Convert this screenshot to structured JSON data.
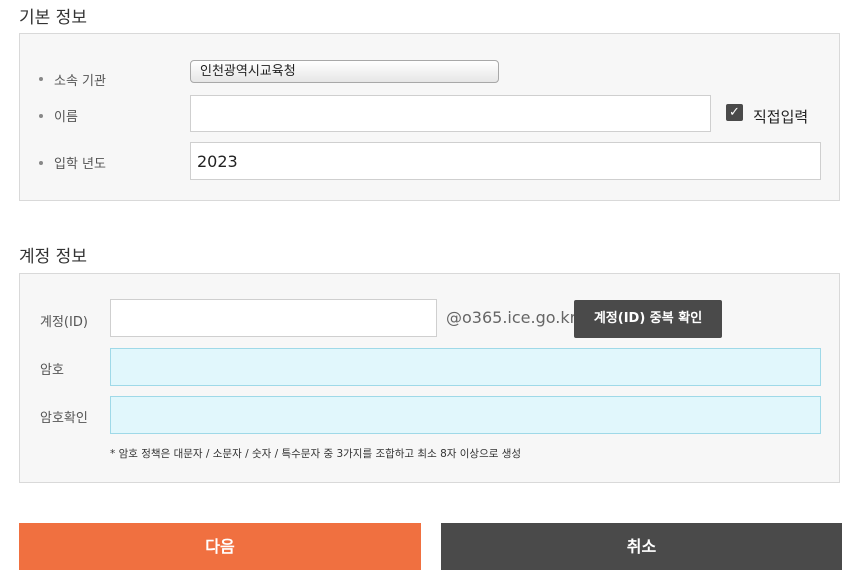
{
  "basic_info": {
    "title": "기본 정보",
    "org_label": "소속 기관",
    "org_value": "인천광역시교육청",
    "name_label": "이름",
    "name_value": "",
    "direct_input_label": "직접입력",
    "direct_input_checked": true,
    "year_label": "입학 년도",
    "year_value": "2023"
  },
  "account_info": {
    "title": "계정 정보",
    "id_label": "계정(ID)",
    "id_value": "",
    "domain": "@o365.ice.go.kr",
    "dup_check_label": "계정(ID) 중복 확인",
    "password_label": "암호",
    "password_confirm_label": "암호확인",
    "password_note": "* 암호 정책은 대문자 / 소문자 / 숫자 / 특수문자 중 3가지를 조합하고 최소 8자 이상으로 생성"
  },
  "actions": {
    "next_label": "다음",
    "cancel_label": "취소"
  },
  "colors": {
    "next_button": "#f07040",
    "cancel_button": "#4a4a4a",
    "password_field": "#e1f7fc"
  }
}
